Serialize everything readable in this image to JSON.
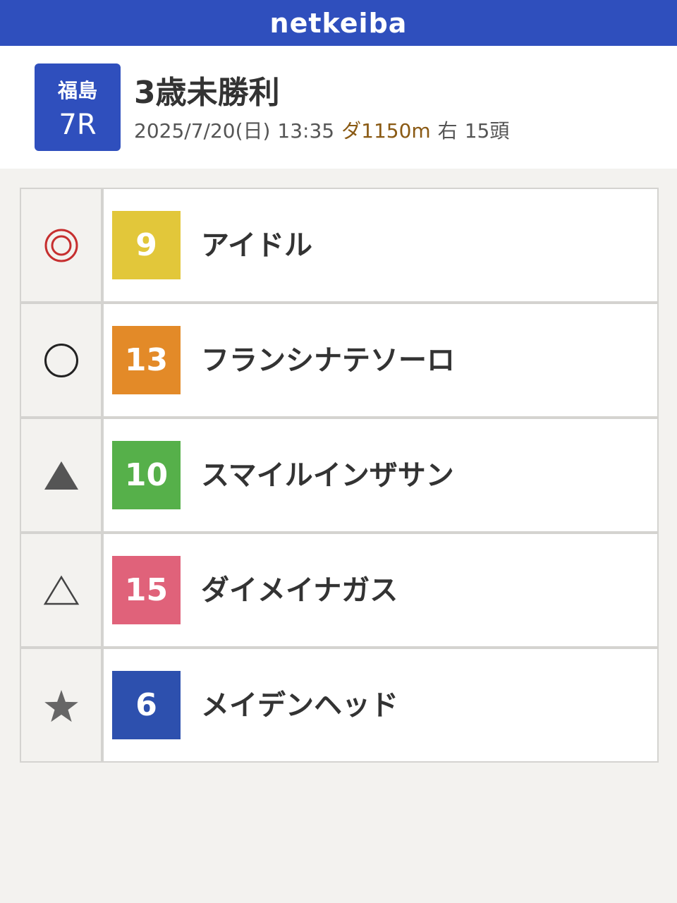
{
  "header": {
    "logo": "netkeiba",
    "brand_color": "#2f4fbd"
  },
  "race": {
    "venue": "福島",
    "number": "7R",
    "title": "3歳未勝利",
    "date": "2025/7/20(日)",
    "time": "13:35",
    "course": "ダ1150m",
    "direction": "右",
    "runners": "15頭"
  },
  "picks": [
    {
      "mark": "double-circle-icon",
      "number": "9",
      "name": "アイドル",
      "color": "#e2c73a"
    },
    {
      "mark": "circle-icon",
      "number": "13",
      "name": "フランシナテソーロ",
      "color": "#e38a28"
    },
    {
      "mark": "filled-triangle-icon",
      "number": "10",
      "name": "スマイルインザサン",
      "color": "#56b04a"
    },
    {
      "mark": "outline-triangle-icon",
      "number": "15",
      "name": "ダイメイナガス",
      "color": "#e0627a"
    },
    {
      "mark": "star-icon",
      "number": "6",
      "name": "メイデンヘッド",
      "color": "#2d50ae"
    }
  ]
}
